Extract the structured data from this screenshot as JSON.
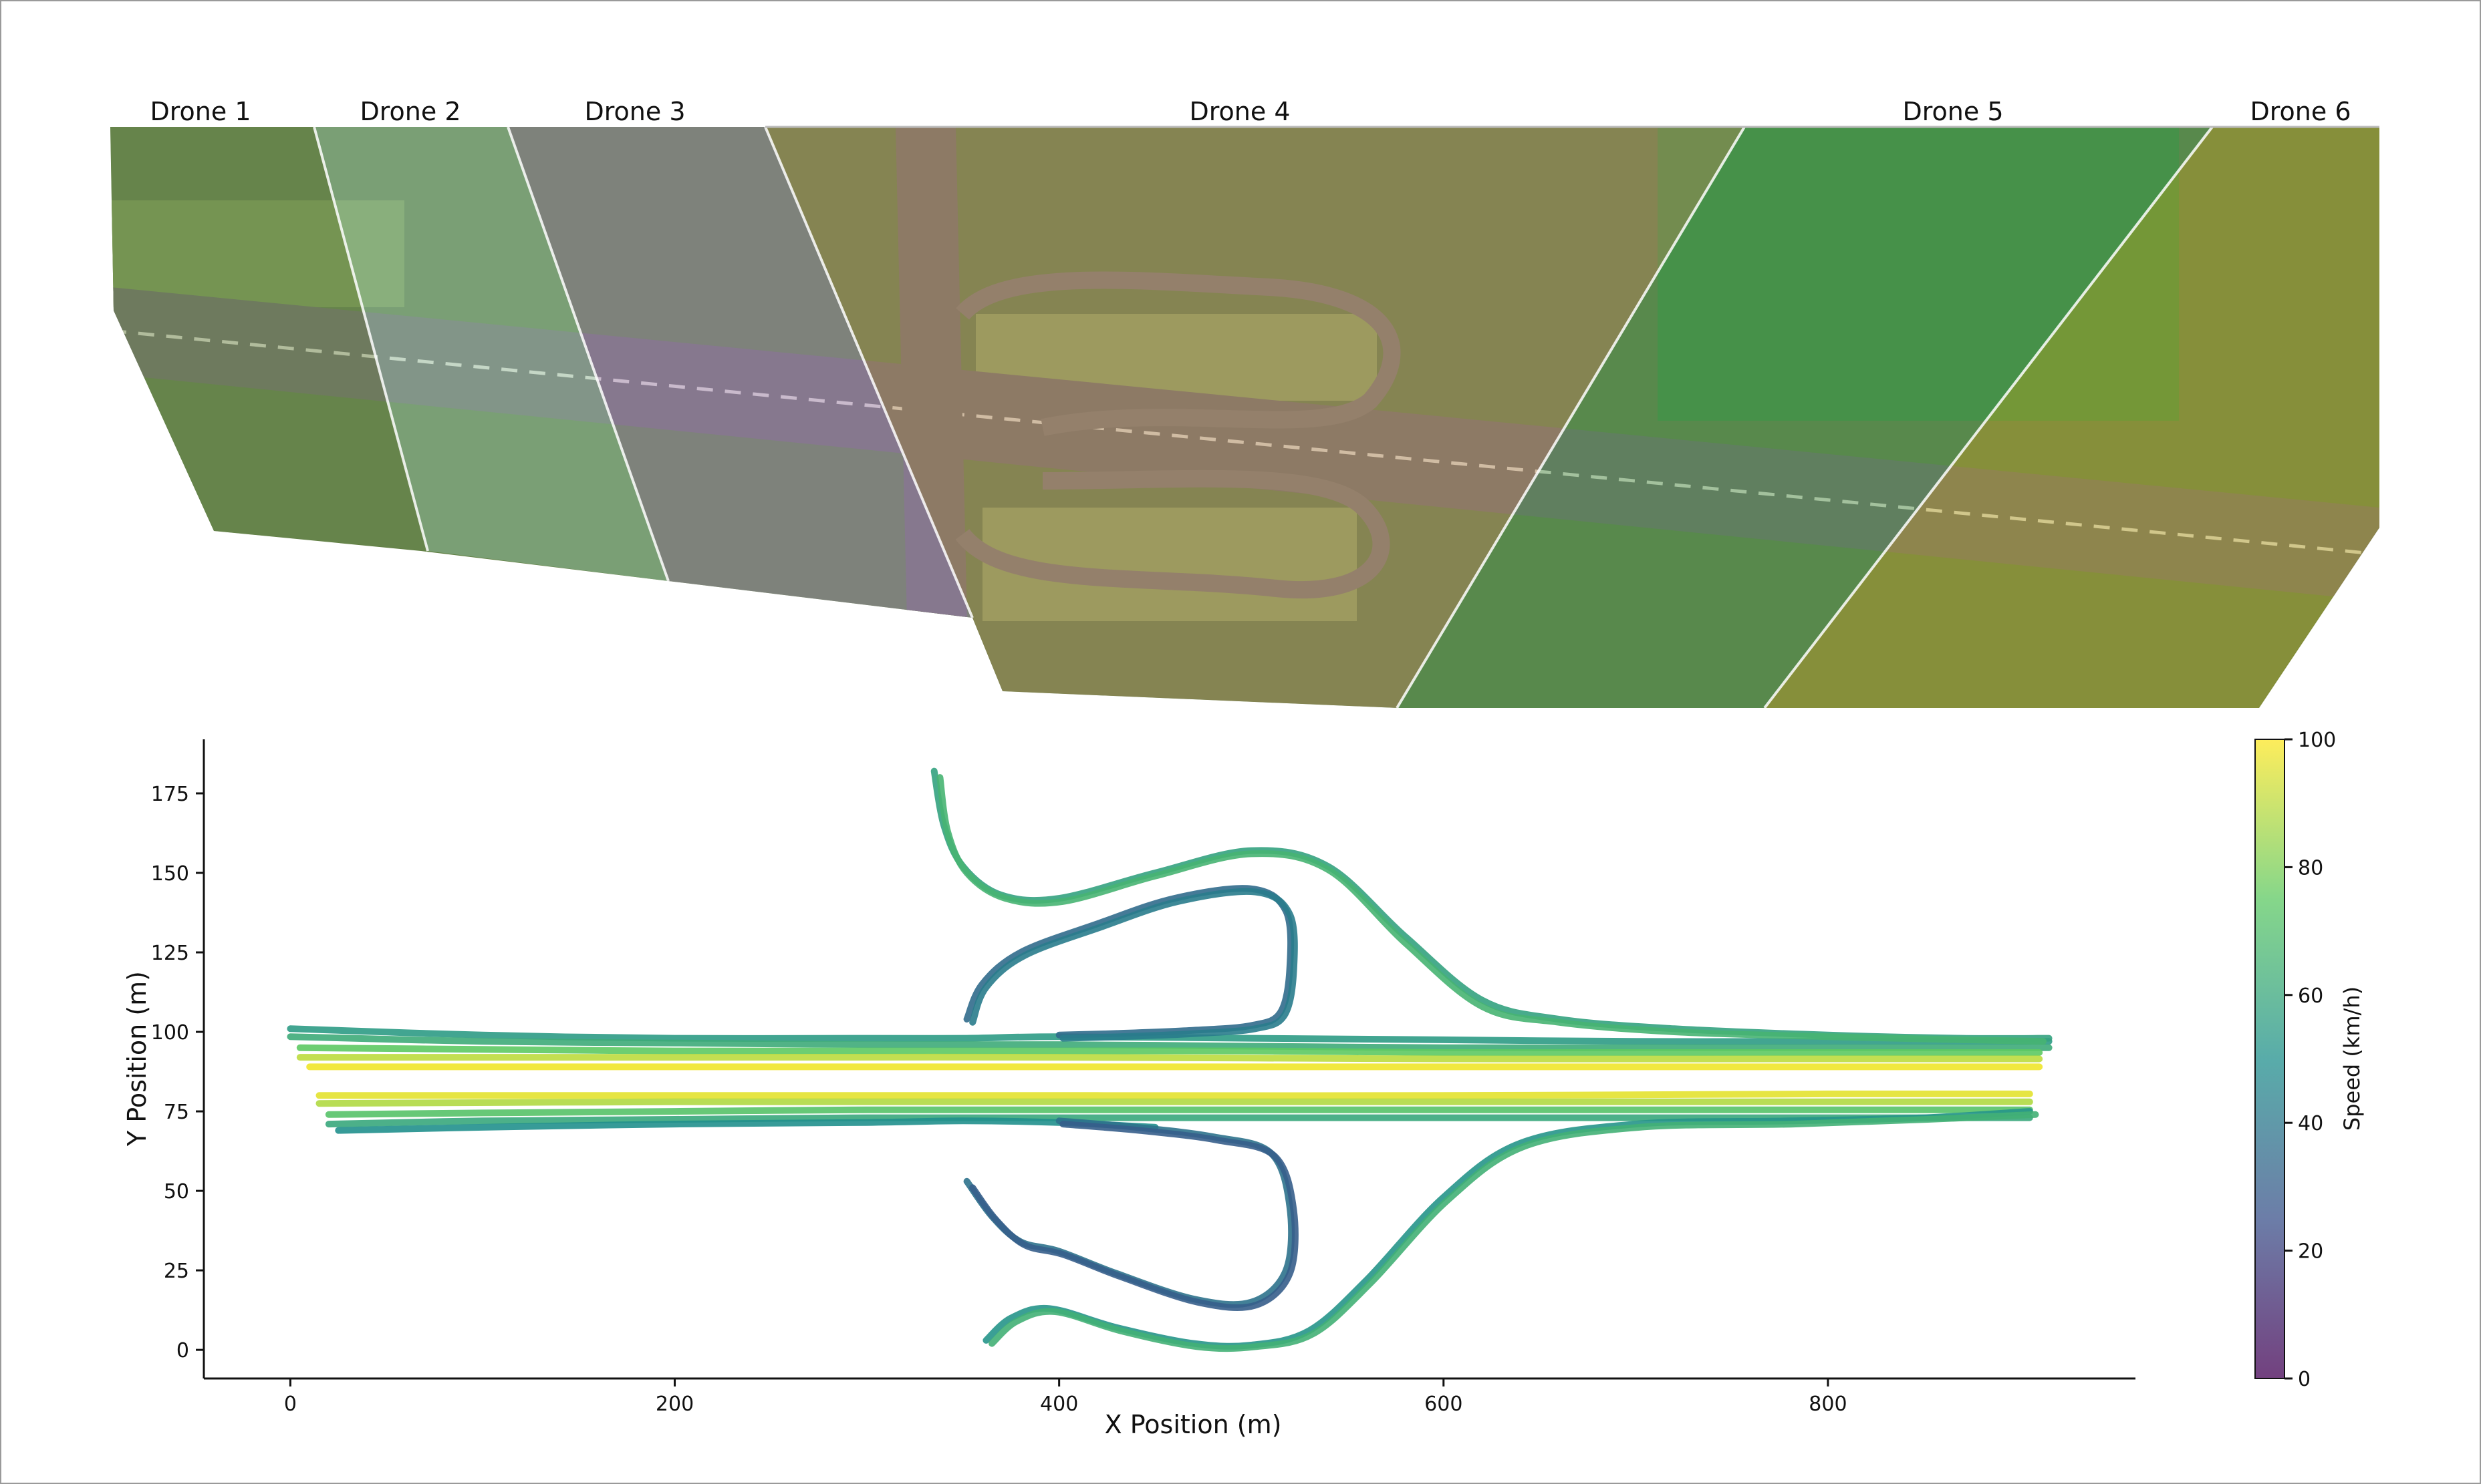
{
  "aerial_panel": {
    "drone_labels": [
      "Drone 1",
      "Drone 2",
      "Drone 3",
      "Drone 4",
      "Drone 5",
      "Drone 6"
    ],
    "tint_colors": [
      "#6f8f5a",
      "#9cc9b8",
      "#a48ac6",
      "#b38d6a",
      "#4f9a5e",
      "#b6a636"
    ],
    "road_color": "#6e6a62",
    "vegetation_color": "#5f7d3f"
  },
  "chart_data": {
    "type": "line",
    "xlabel": "X Position (m)",
    "ylabel": "Y Position (m)",
    "xlim": [
      -45,
      960
    ],
    "ylim": [
      -9,
      192
    ],
    "xticks": [
      0,
      200,
      400,
      600,
      800
    ],
    "yticks": [
      0,
      25,
      50,
      75,
      100,
      125,
      150,
      175
    ],
    "colorbar": {
      "label": "Speed (km/h)",
      "range": [
        0,
        100
      ],
      "ticks": [
        0,
        20,
        40,
        60,
        80,
        100
      ],
      "colormap": [
        "#440154",
        "#3b528b",
        "#21908d",
        "#5dc963",
        "#fde725"
      ]
    },
    "series": [
      {
        "x": [
          0,
          100,
          200,
          300,
          350,
          400,
          500,
          600,
          700,
          800,
          915
        ],
        "y": [
          101,
          99,
          98,
          98,
          98,
          98.5,
          98,
          97.5,
          97,
          97,
          97
        ],
        "speed": 55
      },
      {
        "x": [
          0,
          100,
          200,
          300,
          400,
          500,
          600,
          700,
          800,
          915
        ],
        "y": [
          98.5,
          97,
          96.5,
          96,
          96,
          95.5,
          95,
          95,
          95,
          95
        ],
        "speed": 62
      },
      {
        "x": [
          5,
          100,
          200,
          300,
          400,
          500,
          600,
          700,
          800,
          910
        ],
        "y": [
          95,
          94.5,
          94,
          94,
          94,
          94,
          93.5,
          93.5,
          93.5,
          93.5
        ],
        "speed": 75
      },
      {
        "x": [
          5,
          200,
          400,
          600,
          800,
          910
        ],
        "y": [
          92,
          92,
          92,
          91.5,
          91.5,
          91.5
        ],
        "speed": 90
      },
      {
        "x": [
          10,
          200,
          400,
          600,
          800,
          910
        ],
        "y": [
          89,
          89,
          89,
          89,
          89,
          89
        ],
        "speed": 98
      },
      {
        "x": [
          15,
          200,
          400,
          600,
          800,
          905
        ],
        "y": [
          80,
          80,
          80,
          80,
          80.5,
          80.5
        ],
        "speed": 96
      },
      {
        "x": [
          15,
          200,
          400,
          600,
          800,
          905
        ],
        "y": [
          77.5,
          78,
          78,
          78,
          78,
          78
        ],
        "speed": 88
      },
      {
        "x": [
          20,
          100,
          200,
          300,
          400,
          500,
          600,
          700,
          800,
          905
        ],
        "y": [
          74,
          74.5,
          75,
          75.5,
          75.5,
          75.5,
          75.5,
          75.5,
          75.5,
          75.5
        ],
        "speed": 72
      },
      {
        "x": [
          20,
          100,
          200,
          300,
          400,
          500,
          600,
          700,
          800,
          905
        ],
        "y": [
          71,
          72,
          72.5,
          73,
          73,
          73,
          73,
          73,
          73,
          73
        ],
        "speed": 60
      },
      {
        "x": [
          25,
          100,
          200,
          300,
          350,
          400,
          450
        ],
        "y": [
          69,
          70,
          71,
          71.5,
          72,
          71.5,
          70
        ],
        "speed": 50
      },
      {
        "x": [
          335,
          340,
          350,
          370,
          400,
          450,
          500,
          540,
          580,
          620,
          660,
          720,
          800,
          870,
          915
        ],
        "y": [
          182,
          165,
          152,
          143,
          142,
          150,
          157,
          152,
          130,
          110,
          104,
          101,
          99,
          98,
          98
        ],
        "speed": 58
      },
      {
        "x": [
          338,
          342,
          352,
          372,
          402,
          450,
          500,
          540,
          580,
          620,
          660,
          720,
          800,
          870,
          912
        ],
        "y": [
          180,
          163,
          150,
          142,
          141,
          149,
          156,
          151,
          128,
          108,
          103,
          100,
          98.5,
          97.5,
          97
        ],
        "speed": 66
      },
      {
        "x": [
          352,
          360,
          380,
          420,
          460,
          500,
          518,
          520,
          515,
          500,
          470,
          430,
          400
        ],
        "y": [
          104,
          115,
          125,
          134,
          142,
          145,
          138,
          120,
          106,
          102,
          100.5,
          99.5,
          99
        ],
        "speed": 35
      },
      {
        "x": [
          355,
          362,
          382,
          422,
          462,
          502,
          520,
          522,
          517,
          502,
          472,
          432,
          402
        ],
        "y": [
          103,
          114,
          124,
          133,
          141,
          144,
          137,
          119,
          105,
          101,
          99.5,
          98.5,
          98
        ],
        "speed": 42
      },
      {
        "x": [
          400,
          440,
          480,
          510,
          520,
          518,
          500,
          470,
          430,
          400,
          380,
          365,
          352
        ],
        "y": [
          72,
          70,
          67,
          62,
          45,
          25,
          15,
          16,
          24,
          31,
          34,
          42,
          53
        ],
        "speed": 38
      },
      {
        "x": [
          402,
          442,
          482,
          512,
          522,
          520,
          502,
          472,
          432,
          402,
          382,
          367,
          355
        ],
        "y": [
          71,
          69,
          66,
          61,
          44,
          24,
          14,
          15,
          23,
          30,
          33,
          41,
          51
        ],
        "speed": 30
      },
      {
        "x": [
          362,
          375,
          395,
          430,
          470,
          500,
          530,
          560,
          600,
          640,
          700,
          780,
          850,
          905
        ],
        "y": [
          3,
          10,
          13,
          7,
          2,
          1.5,
          6,
          22,
          48,
          65,
          71,
          72,
          73,
          75
        ],
        "speed": 52
      },
      {
        "x": [
          365,
          378,
          398,
          432,
          472,
          502,
          532,
          562,
          602,
          642,
          702,
          782,
          852,
          908
        ],
        "y": [
          2,
          9,
          12,
          6,
          1,
          1,
          5,
          21,
          47,
          64,
          70,
          71,
          72.5,
          74
        ],
        "speed": 64
      }
    ]
  }
}
